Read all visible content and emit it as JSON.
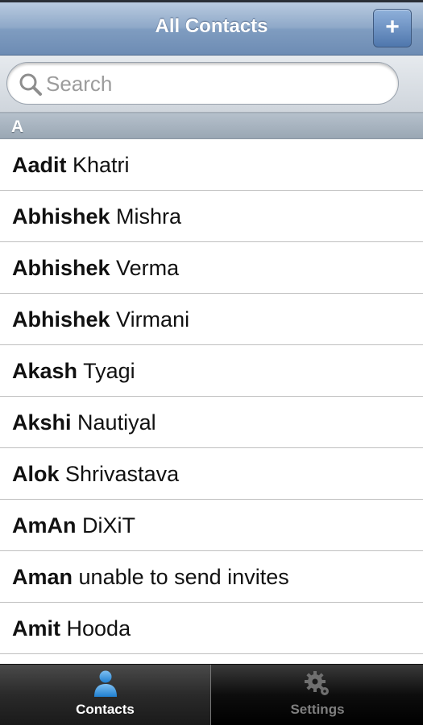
{
  "header": {
    "title": "All Contacts",
    "add_label": "+"
  },
  "search": {
    "placeholder": "Search",
    "value": ""
  },
  "section": {
    "letter": "A"
  },
  "contacts": [
    {
      "first": "Aadit",
      "last": "Khatri"
    },
    {
      "first": "Abhishek",
      "last": "Mishra"
    },
    {
      "first": "Abhishek",
      "last": "Verma"
    },
    {
      "first": "Abhishek",
      "last": "Virmani"
    },
    {
      "first": "Akash",
      "last": "Tyagi"
    },
    {
      "first": "Akshi",
      "last": "Nautiyal"
    },
    {
      "first": "Alok",
      "last": "Shrivastava"
    },
    {
      "first": "AmAn",
      "last": "DiXiT"
    },
    {
      "first": "Aman",
      "last": "unable to send invites"
    },
    {
      "first": "Amit",
      "last": "Hooda"
    }
  ],
  "tabs": {
    "contacts": {
      "label": "Contacts",
      "icon": "person-icon"
    },
    "settings": {
      "label": "Settings",
      "icon": "gear-icon"
    }
  }
}
